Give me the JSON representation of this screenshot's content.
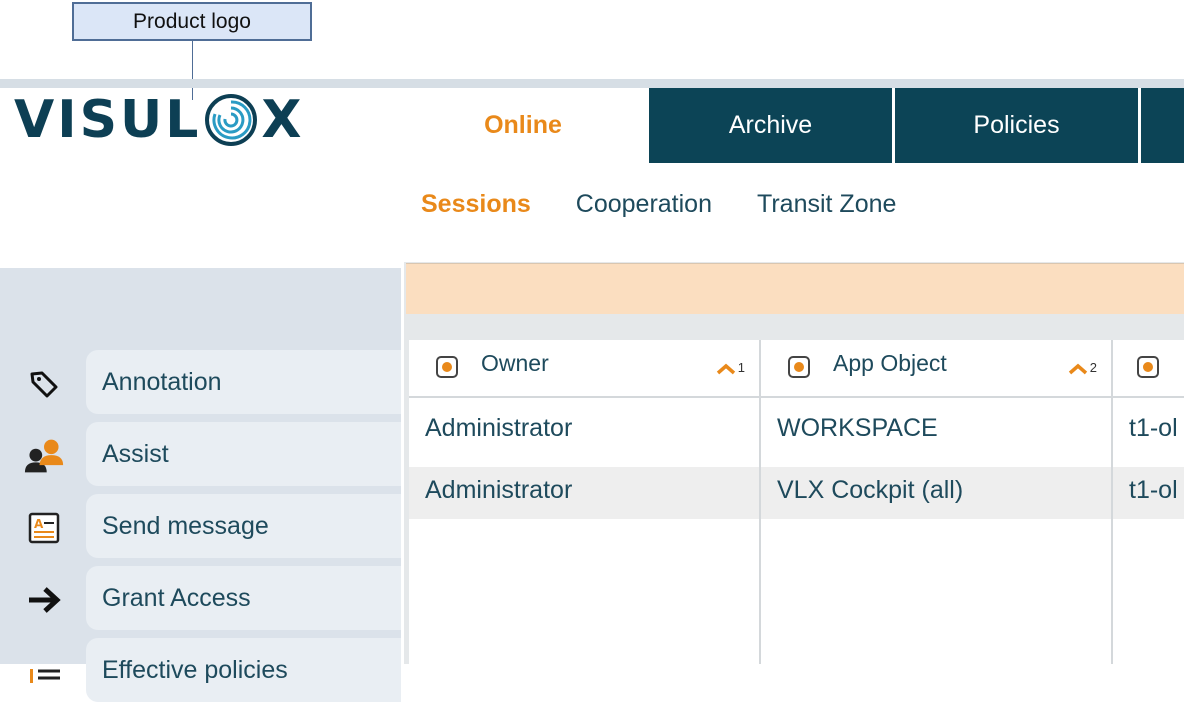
{
  "annotation": {
    "callout_label": "Product logo"
  },
  "app": {
    "logo_text_left": "VISUL",
    "logo_text_right": "X",
    "brand_color": "#0d3f54",
    "accent_color": "#e9891a"
  },
  "tabs": [
    {
      "label": "Online",
      "active": true
    },
    {
      "label": "Archive",
      "active": false
    },
    {
      "label": "Policies",
      "active": false
    }
  ],
  "subnav": [
    {
      "label": "Sessions",
      "active": true
    },
    {
      "label": "Cooperation",
      "active": false
    },
    {
      "label": "Transit Zone",
      "active": false
    }
  ],
  "sidebar": {
    "items": [
      {
        "label": "Annotation",
        "icon": "tag-icon"
      },
      {
        "label": "Assist",
        "icon": "users-icon"
      },
      {
        "label": "Send message",
        "icon": "message-icon"
      },
      {
        "label": "Grant Access",
        "icon": "arrow-right-icon"
      },
      {
        "label": "Effective policies",
        "icon": "list-icon"
      }
    ]
  },
  "table": {
    "columns": [
      {
        "label": "Owner",
        "sort_order": "1"
      },
      {
        "label": "App Object",
        "sort_order": "2"
      },
      {
        "label": ""
      }
    ],
    "rows": [
      [
        "Administrator",
        "WORKSPACE",
        "t1-ol"
      ],
      [
        "Administrator",
        "VLX Cockpit (all)",
        "t1-ol"
      ]
    ]
  }
}
